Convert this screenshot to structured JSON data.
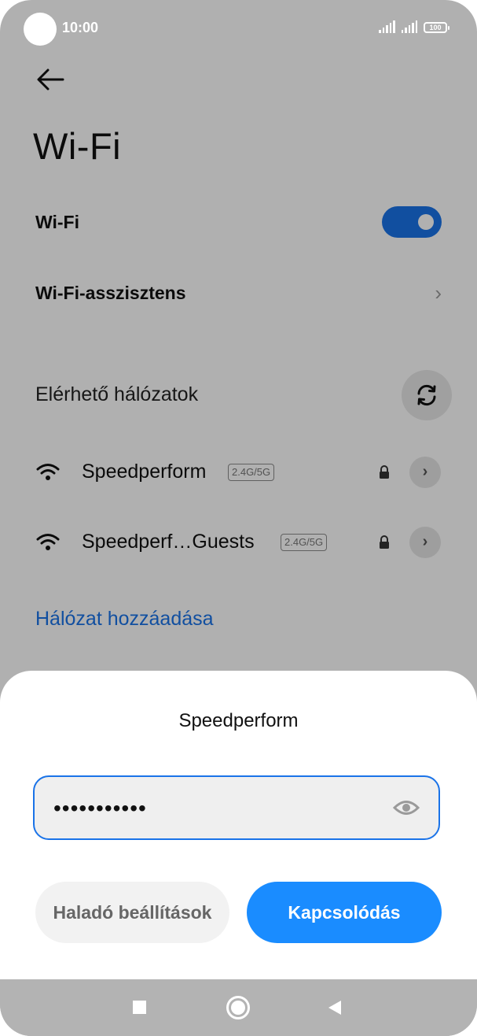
{
  "status_bar": {
    "time": "10:00",
    "battery": "100"
  },
  "page": {
    "title": "Wi-Fi",
    "wifi_toggle_label": "Wi-Fi",
    "wifi_enabled": true,
    "assistant_label": "Wi-Fi-asszisztens",
    "available_networks_label": "Elérhető hálózatok",
    "networks": [
      {
        "name": "Speedperform",
        "band": "2.4G/5G",
        "secured": true
      },
      {
        "name": "Speedperf…Guests",
        "band": "2.4G/5G",
        "secured": true
      }
    ],
    "add_network_label": "Hálózat hozzáadása"
  },
  "dialog": {
    "title": "Speedperform",
    "password_value": "•••••••••••",
    "advanced_button": "Haladó beállítások",
    "connect_button": "Kapcsolódás"
  },
  "colors": {
    "accent": "#1a73e8",
    "connect_button": "#1a8cff",
    "overlay": "rgba(0,0,0,0.31)"
  },
  "icons": {
    "back": "arrow-left-icon",
    "refresh": "refresh-icon",
    "wifi": "wifi-signal-icon",
    "lock": "lock-icon",
    "detail": "chevron-right-icon",
    "password_visibility": "eye-icon"
  }
}
